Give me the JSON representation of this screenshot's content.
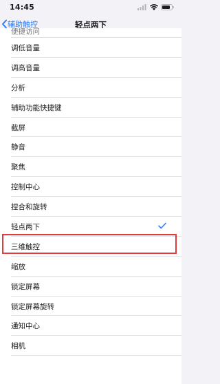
{
  "status_bar": {
    "time": "14:45"
  },
  "nav": {
    "back_label": "辅助触控",
    "title": "轻点两下"
  },
  "items": [
    {
      "label": "便捷访问"
    },
    {
      "label": "调低音量"
    },
    {
      "label": "调高音量"
    },
    {
      "label": "分析"
    },
    {
      "label": "辅助功能快捷键"
    },
    {
      "label": "截屏"
    },
    {
      "label": "静音"
    },
    {
      "label": "聚焦"
    },
    {
      "label": "控制中心"
    },
    {
      "label": "捏合和旋转"
    },
    {
      "label": "轻点两下",
      "selected": true
    },
    {
      "label": "三维触控"
    },
    {
      "label": "缩放"
    },
    {
      "label": "锁定屏幕"
    },
    {
      "label": "锁定屏幕旋转"
    },
    {
      "label": "通知中心"
    },
    {
      "label": "相机"
    }
  ],
  "colors": {
    "accent": "#2f7cf6",
    "highlight": "#e23b3b"
  }
}
